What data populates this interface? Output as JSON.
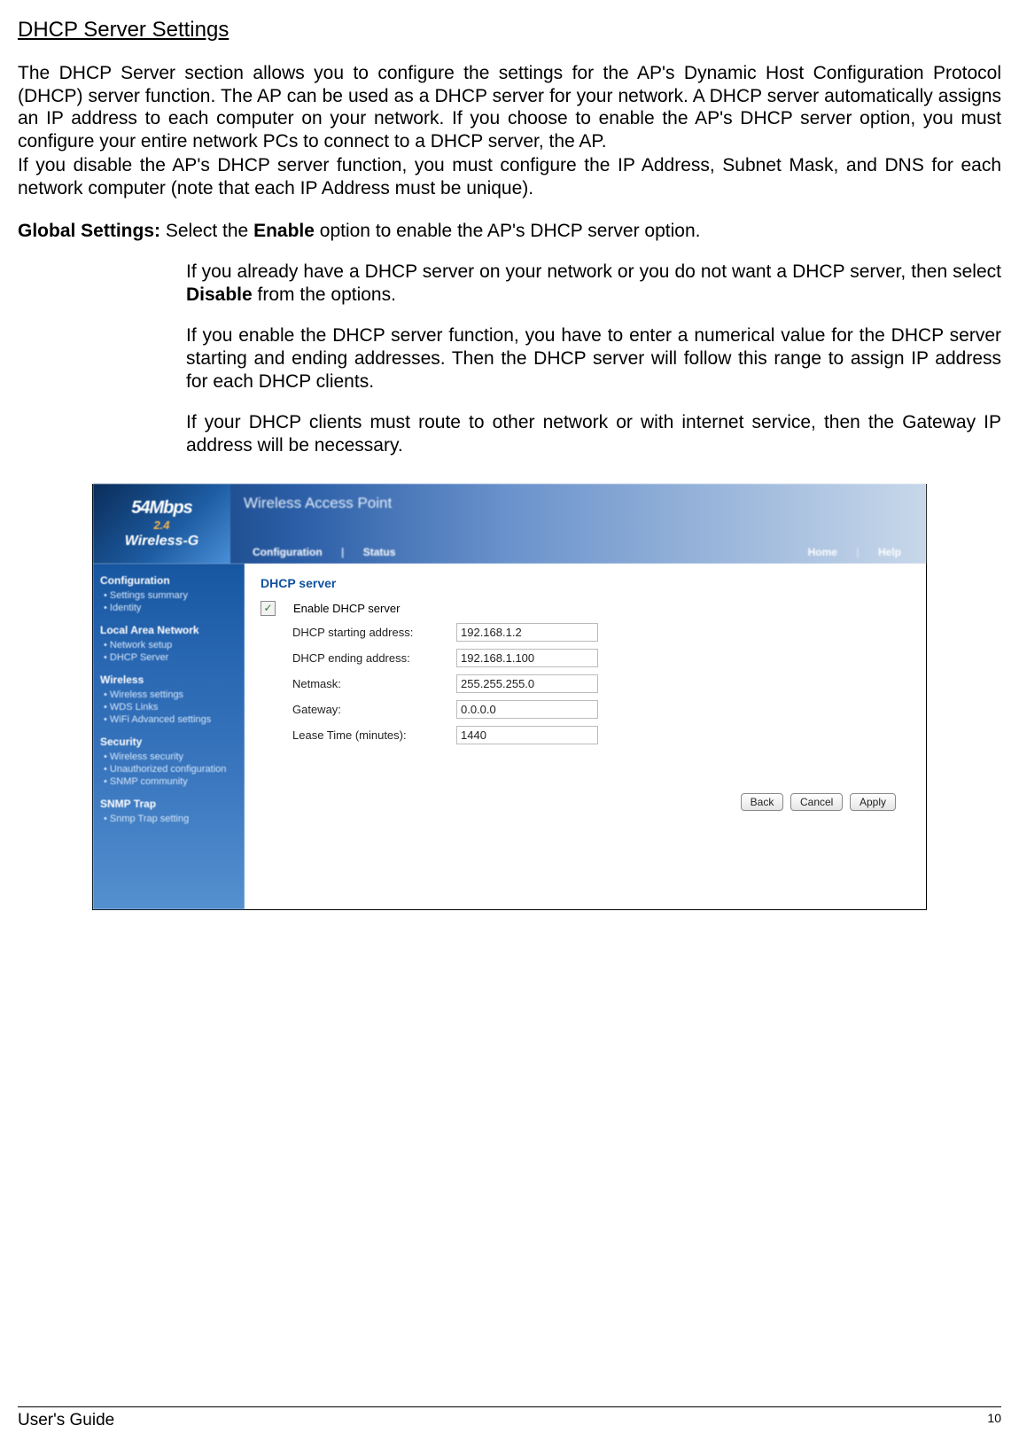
{
  "doc": {
    "heading": "DHCP Server  Settings",
    "para1": "The DHCP Server section allows you to configure the settings for the AP's Dynamic Host Configuration Protocol (DHCP) server function. The AP can be used as a DHCP server for your network. A DHCP server automatically assigns an IP address to each computer on your network. If you choose to enable the AP's DHCP server option, you must configure your entire network PCs to connect to a DHCP server, the AP.",
    "para2": "If you disable the AP's DHCP server function, you must configure the IP Address, Subnet Mask, and DNS for each network computer (note that each IP Address must be unique).",
    "global_label": "Global Settings: ",
    "global_line1a": "Select the ",
    "global_enable": "Enable",
    "global_line1b": " option to enable the AP's DHCP server option.",
    "global_line2a": "If you already have a DHCP server on your network or you do not want a DHCP server, then select ",
    "global_disable": "Disable",
    "global_line2b": " from the options.",
    "global_line3": "If you enable the DHCP server function, you have to enter a numerical value for the DHCP server starting and ending addresses. Then the DHCP server will follow this range to assign IP address for each DHCP clients.",
    "global_line4": "If your DHCP clients must route to other network or with internet service, then the Gateway IP address will be necessary.",
    "footer_left": "User's Guide",
    "footer_right": "10"
  },
  "ap": {
    "logo_top": "54Mbps",
    "logo_mid": "2.4",
    "logo_bot": "Wireless-G",
    "title": "Wireless Access Point",
    "topnav_left": [
      "Configuration",
      "Status"
    ],
    "topnav_right": [
      "Home",
      "Help"
    ],
    "sidebar": [
      {
        "head": "Configuration",
        "items": [
          "Settings summary",
          "Identity"
        ]
      },
      {
        "head": "Local Area Network",
        "items": [
          "Network setup",
          "DHCP Server"
        ]
      },
      {
        "head": "Wireless",
        "items": [
          "Wireless settings",
          "WDS Links",
          "WiFi Advanced settings"
        ]
      },
      {
        "head": "Security",
        "items": [
          "Wireless security",
          "Unauthorized configuration",
          "SNMP community"
        ]
      },
      {
        "head": "SNMP Trap",
        "items": [
          "Snmp Trap setting"
        ]
      }
    ],
    "panel_title": "DHCP server",
    "enable_label": "Enable DHCP server",
    "fields": {
      "start_label": "DHCP starting address:",
      "start_value": "192.168.1.2",
      "end_label": "DHCP ending address:",
      "end_value": "192.168.1.100",
      "mask_label": "Netmask:",
      "mask_value": "255.255.255.0",
      "gw_label": "Gateway:",
      "gw_value": "0.0.0.0",
      "lease_label": "Lease Time (minutes):",
      "lease_value": "1440"
    },
    "buttons": {
      "back": "Back",
      "cancel": "Cancel",
      "apply": "Apply"
    }
  }
}
